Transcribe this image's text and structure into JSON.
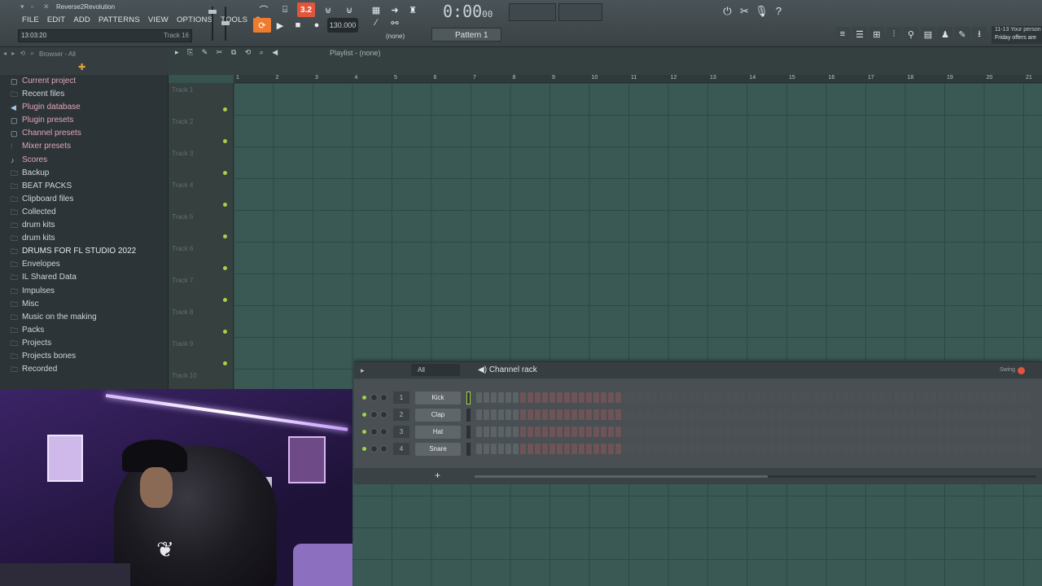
{
  "app": {
    "title": "Reverse2Revolution",
    "menu": [
      "FILE",
      "EDIT",
      "ADD",
      "PATTERNS",
      "VIEW",
      "OPTIONS",
      "TOOLS",
      "?"
    ],
    "hint_time": "13:03:20",
    "hint_track": "Track 16"
  },
  "transport": {
    "tempo": "130.000",
    "song_time": "0:00",
    "song_time_small": "00",
    "pattern_select": "(none)",
    "pattern_label": "Pattern 1",
    "news_line1": "11-13  Your person",
    "news_line2": "Friday offers are"
  },
  "browser": {
    "title": "Browser - All",
    "items": [
      {
        "label": "Current project",
        "icon": "folder-project-icon",
        "special": true
      },
      {
        "label": "Recent files",
        "icon": "folder-recent-icon",
        "special": false
      },
      {
        "label": "Plugin database",
        "icon": "plugin-icon",
        "special": true
      },
      {
        "label": "Plugin presets",
        "icon": "plugin-preset-icon",
        "special": true
      },
      {
        "label": "Channel presets",
        "icon": "channel-icon",
        "special": true
      },
      {
        "label": "Mixer presets",
        "icon": "mixer-icon",
        "special": true
      },
      {
        "label": "Scores",
        "icon": "note-icon",
        "special": true
      },
      {
        "label": "Backup",
        "icon": "folder-backup-icon",
        "special": false
      },
      {
        "label": "BEAT PACKS",
        "icon": "folder-icon",
        "special": false
      },
      {
        "label": "Clipboard files",
        "icon": "folder-icon",
        "special": false
      },
      {
        "label": "Collected",
        "icon": "folder-icon",
        "special": false
      },
      {
        "label": "drum kits",
        "icon": "folder-icon",
        "special": false
      },
      {
        "label": "drum kits",
        "icon": "folder-icon",
        "special": false
      },
      {
        "label": "DRUMS FOR FL STUDIO 2022",
        "icon": "folder-icon",
        "special": false
      },
      {
        "label": "Envelopes",
        "icon": "folder-icon",
        "special": false
      },
      {
        "label": "IL Shared Data",
        "icon": "folder-icon",
        "special": false
      },
      {
        "label": "Impulses",
        "icon": "folder-icon",
        "special": false
      },
      {
        "label": "Misc",
        "icon": "folder-icon",
        "special": false
      },
      {
        "label": "Music on the making",
        "icon": "folder-icon",
        "special": false
      },
      {
        "label": "Packs",
        "icon": "folder-icon",
        "special": false
      },
      {
        "label": "Projects",
        "icon": "folder-icon",
        "special": false
      },
      {
        "label": "Projects bones",
        "icon": "folder-icon",
        "special": false
      },
      {
        "label": "Recorded",
        "icon": "folder-icon",
        "special": false
      }
    ]
  },
  "playlist": {
    "title": "Playlist - (none)",
    "ruler": [
      "1",
      "2",
      "3",
      "4",
      "5",
      "6",
      "7",
      "8",
      "9",
      "10",
      "11",
      "12",
      "13",
      "14",
      "15",
      "16",
      "17",
      "18",
      "19",
      "20",
      "21"
    ],
    "tracks": [
      "Track 1",
      "Track 2",
      "Track 3",
      "Track 4",
      "Track 5",
      "Track 6",
      "Track 7",
      "Track 8",
      "Track 9",
      "Track 10"
    ]
  },
  "channel_rack": {
    "title": "Channel rack",
    "filter": "All",
    "swing_label": "Swing",
    "channels": [
      {
        "num": "1",
        "name": "Kick"
      },
      {
        "num": "2",
        "name": "Clap"
      },
      {
        "num": "3",
        "name": "Hat"
      },
      {
        "num": "4",
        "name": "Snare"
      }
    ],
    "add_label": "+"
  },
  "colors": {
    "accent_orange": "#ef7b2f",
    "record_red": "#e0563b",
    "led_green": "#a4d24a",
    "playlist_bg": "#3a5954"
  }
}
